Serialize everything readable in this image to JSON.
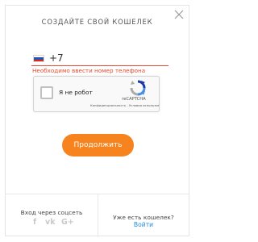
{
  "dialog": {
    "title": "СОЗДАЙТЕ СВОЙ КОШЕЛЕК",
    "close_icon": "close-icon"
  },
  "phone": {
    "country_flag": "russia-flag-icon",
    "prefix": "+7",
    "error": "Необходимо ввести номер телефона",
    "underline_color": "#e14b33"
  },
  "captcha": {
    "checkbox_label": "Я не робот",
    "brand": "reCAPTCHA",
    "terms": "Конфиденциальность - Условия использования",
    "logo_icon": "recaptcha-logo-icon"
  },
  "actions": {
    "continue_label": "Продолжить",
    "continue_color": "#f7831f"
  },
  "footer": {
    "social_title": "Вход через соцсеть",
    "social": [
      {
        "icon": "facebook-icon",
        "glyph": "f"
      },
      {
        "icon": "vk-icon",
        "glyph": "vk"
      },
      {
        "icon": "google-plus-icon",
        "glyph": "G+"
      }
    ],
    "wallet_question": "Уже есть кошелек?",
    "login_link": "Войти",
    "link_color": "#1f8ad6"
  }
}
